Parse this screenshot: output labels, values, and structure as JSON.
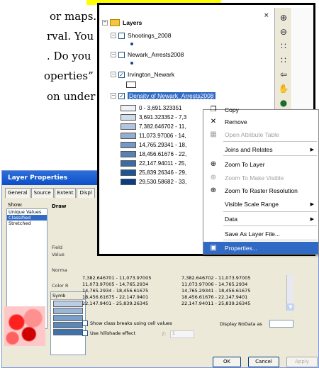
{
  "prose": {
    "lines": [
      "or maps.",
      "rval. You",
      ". Do you",
      "operties”",
      "on under"
    ]
  },
  "toc": {
    "close_glyph": "×",
    "root": "Layers",
    "layers": [
      {
        "name": "Shootings_2008",
        "checked": false
      },
      {
        "name": "Newark_Arrests2008",
        "checked": false
      },
      {
        "name": "Irvington_Newark",
        "checked": true
      },
      {
        "name": "Density of Newark_Arrests2008",
        "checked": true
      }
    ],
    "legend": [
      {
        "label": "0 - 3,691.323351",
        "color": "#eef2f8"
      },
      {
        "label": "3,691.323352 - 7,3",
        "color": "#d0dcea"
      },
      {
        "label": "7,382.646702 - 11,",
        "color": "#b2c5dc"
      },
      {
        "label": "11,073.97006 - 14,",
        "color": "#94afce"
      },
      {
        "label": "14,765.29341 - 18,",
        "color": "#7698c0"
      },
      {
        "label": "18,456.61676 - 22,",
        "color": "#5882b2"
      },
      {
        "label": "22,147.94011 - 25,",
        "color": "#3a6ba4"
      },
      {
        "label": "25,839.26346 - 29,",
        "color": "#1c5596"
      },
      {
        "label": "29,530.58682 - 33,",
        "color": "#0a3f82"
      }
    ]
  },
  "menu": {
    "items": [
      {
        "label": "Copy",
        "icon": "copy-icon",
        "glyph": "❐",
        "disabled": false,
        "submenu": false
      },
      {
        "label": "Remove",
        "icon": "remove-icon",
        "glyph": "✕",
        "disabled": false,
        "submenu": false
      },
      {
        "label": "Open Attribute Table",
        "icon": "table-icon",
        "glyph": "▦",
        "disabled": true,
        "submenu": false
      },
      {
        "label": "Joins and Relates",
        "icon": "",
        "glyph": "",
        "disabled": false,
        "submenu": true
      },
      {
        "label": "Zoom To Layer",
        "icon": "zoom-globe-icon",
        "glyph": "⊕",
        "disabled": false,
        "submenu": false
      },
      {
        "label": "Zoom To Make Visible",
        "icon": "zoom-visible-icon",
        "glyph": "⊕",
        "disabled": true,
        "submenu": false
      },
      {
        "label": "Zoom To Raster Resolution",
        "icon": "zoom-raster-icon",
        "glyph": "⊕",
        "disabled": false,
        "submenu": false
      },
      {
        "label": "Visible Scale Range",
        "icon": "",
        "glyph": "",
        "disabled": false,
        "submenu": true
      },
      {
        "label": "Data",
        "icon": "",
        "glyph": "",
        "disabled": false,
        "submenu": true
      },
      {
        "label": "Save As Layer File...",
        "icon": "",
        "glyph": "",
        "disabled": false,
        "submenu": false
      },
      {
        "label": "Properties...",
        "icon": "properties-icon",
        "glyph": "▣",
        "disabled": false,
        "submenu": false,
        "highlighted": true
      }
    ]
  },
  "tools": {
    "zoom_in": "⊕",
    "zoom_out": "⊖",
    "fixed_in": "∷",
    "fixed_out": "∷",
    "back": "⇦",
    "pan": "✋",
    "globe": "●"
  },
  "dialog": {
    "title": "Layer Properties",
    "tabs": [
      "General",
      "Source",
      "Extent",
      "Displ"
    ],
    "show_label": "Show:",
    "show_items": [
      "Unique Values",
      "Classified",
      "Stretched"
    ],
    "show_selected": "Classified",
    "draw_label": "Draw",
    "side_labels": [
      "Field",
      "Value",
      "Norma",
      "Color R"
    ],
    "sym_header": "Symb",
    "sym_colors": [
      "#b9cde6",
      "#9ab6d7",
      "#7b9fc8",
      "#5c88b9",
      "#3d71aa"
    ],
    "classes": [
      [
        "7,382.646701 - 11,073.97005",
        "7,382.646702 - 11,073.97005"
      ],
      [
        "11,073.97005 - 14,765.2934",
        "11,073.97006 - 14,765.2934"
      ],
      [
        "14,765.2934 - 18,456.61675",
        "14,765.29341 - 18,456.61675"
      ],
      [
        "18,456.61675 - 22,147.9401",
        "18,456.61676 - 22,147.9401"
      ],
      [
        "22,147.9401 - 25,839.26345",
        "22,147.94011 - 25,839.26345"
      ]
    ],
    "checkbox_breaks": "Show class breaks using cell values",
    "checkbox_hillshade": "Use hillshade effect",
    "z_label": "Z:",
    "z_value": "1",
    "nodata_label": "Display NoData as",
    "ok": "OK",
    "cancel": "Cancel",
    "apply": "Apply"
  }
}
